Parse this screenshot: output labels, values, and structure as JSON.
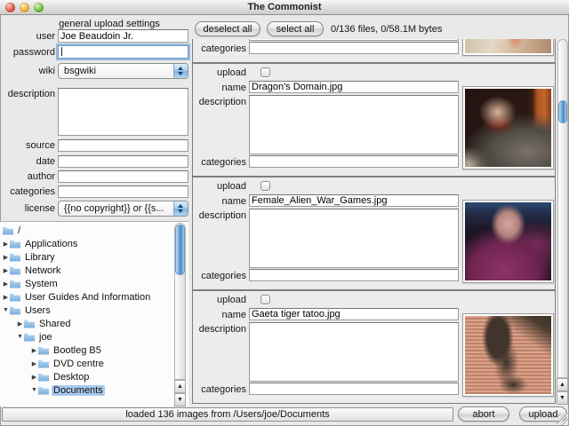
{
  "window": {
    "title": "The Commonist"
  },
  "colors": {
    "aqua_accent": "#5a9ad2",
    "tree_selection": "#a9c9ee"
  },
  "icons": {
    "disclosure_collapsed": "▶",
    "disclosure_expanded": "▼",
    "scroll_up_arrow": "▲",
    "scroll_down_arrow": "▼"
  },
  "settings": {
    "title": "general upload settings",
    "user_label": "user",
    "user_value": "Joe Beaudoin Jr.",
    "password_label": "password",
    "password_value": "",
    "wiki_label": "wiki",
    "wiki_value": "bsgwiki",
    "description_label": "description",
    "description_value": "",
    "source_label": "source",
    "source_value": "",
    "date_label": "date",
    "date_value": "",
    "author_label": "author",
    "author_value": "",
    "categories_label": "categories",
    "categories_value": "",
    "license_label": "license",
    "license_value": "{{no copyright}} or {{s..."
  },
  "tree": {
    "items": [
      {
        "label": "/",
        "level": 0,
        "state": "none"
      },
      {
        "label": "Applications",
        "level": 1,
        "state": "collapsed"
      },
      {
        "label": "Library",
        "level": 1,
        "state": "collapsed"
      },
      {
        "label": "Network",
        "level": 1,
        "state": "collapsed"
      },
      {
        "label": "System",
        "level": 1,
        "state": "collapsed"
      },
      {
        "label": "User Guides And Information",
        "level": 1,
        "state": "collapsed"
      },
      {
        "label": "Users",
        "level": 1,
        "state": "expanded"
      },
      {
        "label": "Shared",
        "level": 2,
        "state": "collapsed"
      },
      {
        "label": "joe",
        "level": 2,
        "state": "expanded"
      },
      {
        "label": "Bootleg B5",
        "level": 3,
        "state": "collapsed"
      },
      {
        "label": "DVD centre",
        "level": 3,
        "state": "collapsed"
      },
      {
        "label": "Desktop",
        "level": 3,
        "state": "collapsed"
      },
      {
        "label": "Documents",
        "level": 3,
        "state": "expanded",
        "selected": true
      }
    ]
  },
  "filelist": {
    "deselect_all_label": "deselect all",
    "select_all_label": "select all",
    "summary": "0/136 files, 0/58.1M bytes",
    "row_labels": {
      "upload": "upload",
      "name": "name",
      "description": "description",
      "categories": "categories"
    },
    "items": [
      {},
      {
        "name": "Dragon's Domain.jpg"
      },
      {
        "name": "Female_Alien_War_Games.jpg"
      },
      {
        "name": "Gaeta tiger tatoo.jpg"
      }
    ]
  },
  "statusbar": {
    "status": "loaded 136 images from /Users/joe/Documents",
    "abort_label": "abort",
    "upload_label": "upload"
  }
}
